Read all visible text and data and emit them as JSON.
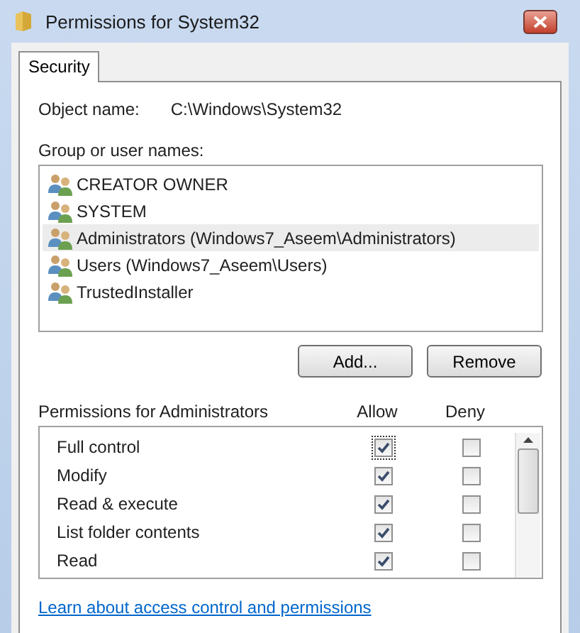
{
  "window": {
    "title": "Permissions for System32"
  },
  "tabs": [
    {
      "label": "Security",
      "selected": true
    }
  ],
  "object_name": {
    "label": "Object name:",
    "value": "C:\\Windows\\System32"
  },
  "groups": {
    "label": "Group or user names:",
    "items": [
      {
        "name": "CREATOR OWNER",
        "selected": false
      },
      {
        "name": "SYSTEM",
        "selected": false
      },
      {
        "name": "Administrators (Windows7_Aseem\\Administrators)",
        "selected": true
      },
      {
        "name": "Users (Windows7_Aseem\\Users)",
        "selected": false
      },
      {
        "name": "TrustedInstaller",
        "selected": false
      }
    ]
  },
  "buttons": [
    "Add...",
    "Remove"
  ],
  "permissions": {
    "label": "Permissions for Administrators",
    "allow_header": "Allow",
    "deny_header": "Deny",
    "items": [
      {
        "name": "Full control",
        "allow": true,
        "deny": false,
        "focused": true
      },
      {
        "name": "Modify",
        "allow": true,
        "deny": false,
        "focused": false
      },
      {
        "name": "Read & execute",
        "allow": true,
        "deny": false,
        "focused": false
      },
      {
        "name": "List folder contents",
        "allow": true,
        "deny": false,
        "focused": false
      },
      {
        "name": "Read",
        "allow": true,
        "deny": false,
        "focused": false
      }
    ]
  },
  "link": "Learn about access control and permissions"
}
